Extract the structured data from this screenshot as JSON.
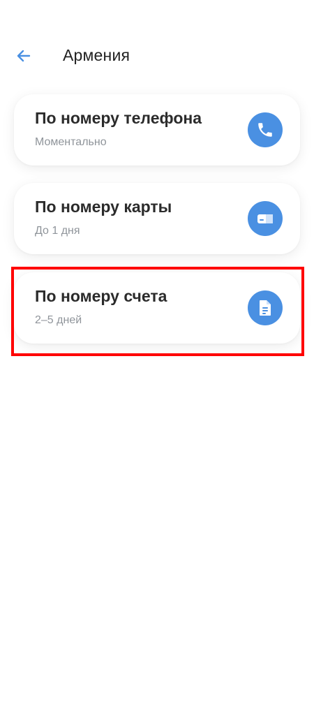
{
  "header": {
    "back_icon": "arrow-left-icon",
    "title": "Армения"
  },
  "accent_color": "#4a90e2",
  "highlight_color": "#ff0000",
  "options": [
    {
      "title": "По номеру телефона",
      "subtitle": "Моментально",
      "icon": "phone-icon"
    },
    {
      "title": "По номеру карты",
      "subtitle": "До 1 дня",
      "icon": "card-icon"
    },
    {
      "title": "По номеру счета",
      "subtitle": "2–5 дней",
      "icon": "document-icon"
    }
  ]
}
